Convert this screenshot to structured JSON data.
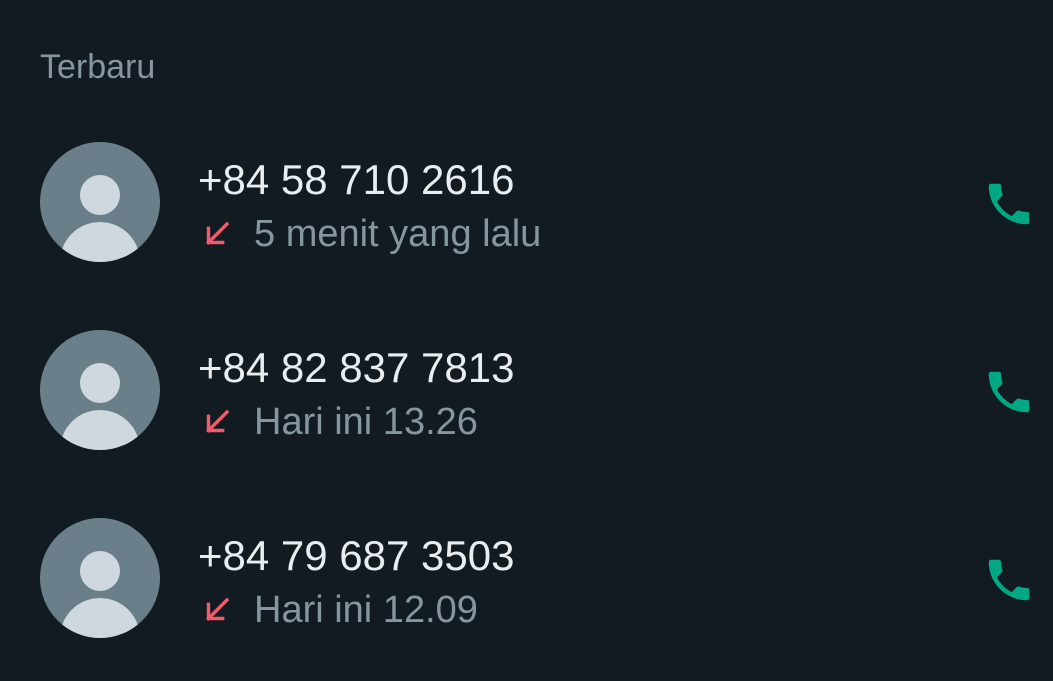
{
  "section": {
    "title": "Terbaru"
  },
  "calls": [
    {
      "number": "+84 58 710 2616",
      "time": "5 menit yang lalu",
      "direction_icon": "missed-call-arrow-icon",
      "action_icon": "phone-icon"
    },
    {
      "number": "+84 82 837 7813",
      "time": "Hari ini 13.26",
      "direction_icon": "missed-call-arrow-icon",
      "action_icon": "phone-icon"
    },
    {
      "number": "+84 79 687 3503",
      "time": "Hari ini 12.09",
      "direction_icon": "missed-call-arrow-icon",
      "action_icon": "phone-icon"
    }
  ],
  "colors": {
    "background": "#111b21",
    "missed": "#f15c6d",
    "call_action": "#00a884",
    "primary_text": "#e9edef",
    "secondary_text": "#8696a0"
  }
}
